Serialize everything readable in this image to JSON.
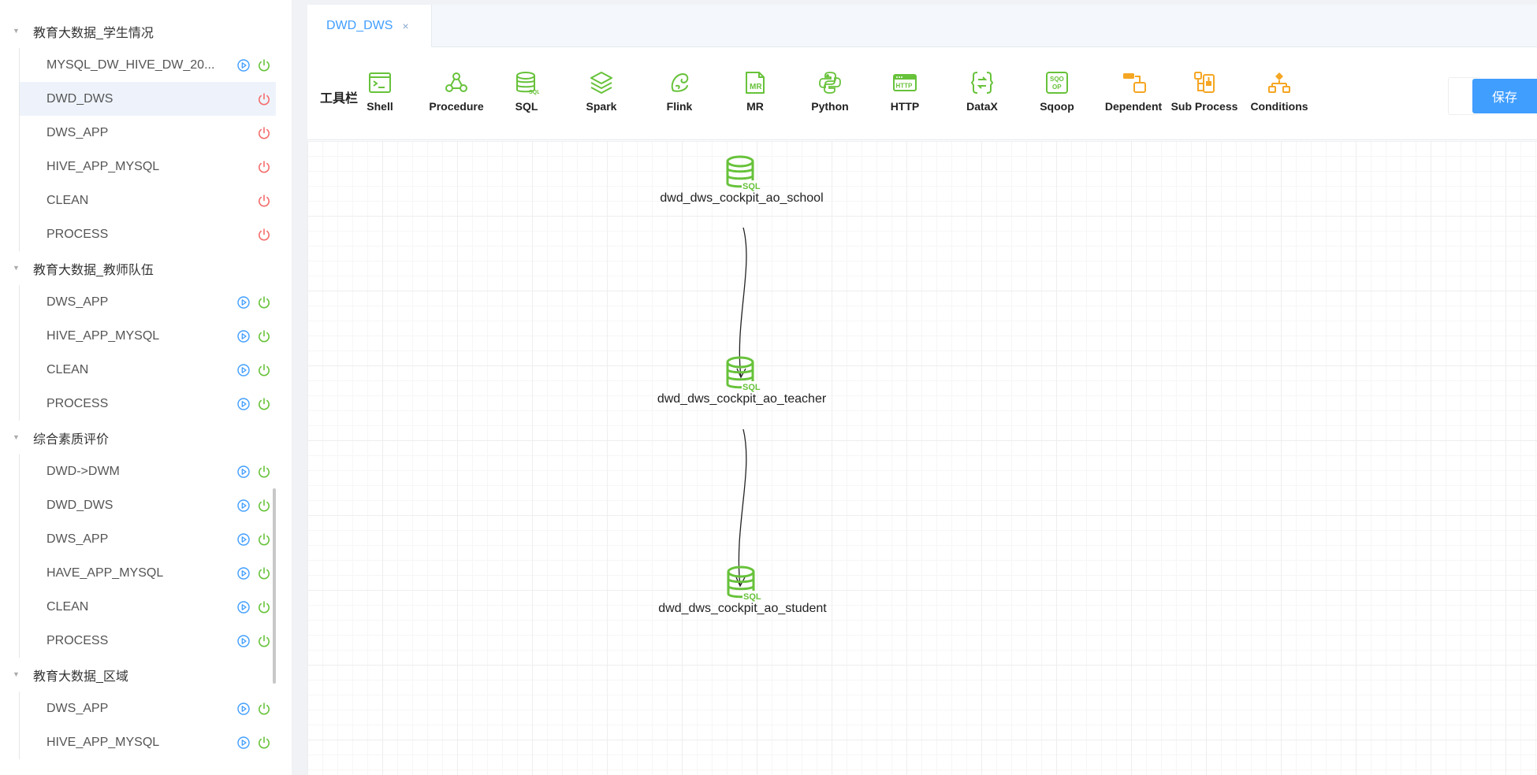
{
  "sidebar": {
    "groups": [
      {
        "label": "教育大数据_学生情况",
        "items": [
          {
            "label": "MYSQL_DW_HIVE_DW_20...",
            "run": true,
            "status": "green",
            "active": false
          },
          {
            "label": "DWD_DWS",
            "run": false,
            "status": "red",
            "active": true
          },
          {
            "label": "DWS_APP",
            "run": false,
            "status": "red",
            "active": false
          },
          {
            "label": "HIVE_APP_MYSQL",
            "run": false,
            "status": "red",
            "active": false
          },
          {
            "label": "CLEAN",
            "run": false,
            "status": "red",
            "active": false
          },
          {
            "label": "PROCESS",
            "run": false,
            "status": "red",
            "active": false
          }
        ]
      },
      {
        "label": "教育大数据_教师队伍",
        "items": [
          {
            "label": "DWS_APP",
            "run": true,
            "status": "green",
            "active": false
          },
          {
            "label": "HIVE_APP_MYSQL",
            "run": true,
            "status": "green",
            "active": false
          },
          {
            "label": "CLEAN",
            "run": true,
            "status": "green",
            "active": false
          },
          {
            "label": "PROCESS",
            "run": true,
            "status": "green",
            "active": false
          }
        ]
      },
      {
        "label": "综合素质评价",
        "items": [
          {
            "label": "DWD->DWM",
            "run": true,
            "status": "green",
            "active": false
          },
          {
            "label": "DWD_DWS",
            "run": true,
            "status": "green",
            "active": false
          },
          {
            "label": "DWS_APP",
            "run": true,
            "status": "green",
            "active": false
          },
          {
            "label": "HAVE_APP_MYSQL",
            "run": true,
            "status": "green",
            "active": false
          },
          {
            "label": "CLEAN",
            "run": true,
            "status": "green",
            "active": false
          },
          {
            "label": "PROCESS",
            "run": true,
            "status": "green",
            "active": false
          }
        ]
      },
      {
        "label": "教育大数据_区域",
        "items": [
          {
            "label": "DWS_APP",
            "run": true,
            "status": "green",
            "active": false
          },
          {
            "label": "HIVE_APP_MYSQL",
            "run": true,
            "status": "green",
            "active": false
          }
        ]
      }
    ]
  },
  "tabs": [
    {
      "label": "DWD_DWS",
      "close": "×"
    }
  ],
  "toolbar": {
    "title": "工具栏",
    "tools": [
      {
        "label": "Shell",
        "icon": "shell-icon"
      },
      {
        "label": "Procedure",
        "icon": "procedure-icon"
      },
      {
        "label": "SQL",
        "icon": "sql-icon"
      },
      {
        "label": "Spark",
        "icon": "spark-icon"
      },
      {
        "label": "Flink",
        "icon": "flink-icon"
      },
      {
        "label": "MR",
        "icon": "mr-icon"
      },
      {
        "label": "Python",
        "icon": "python-icon"
      },
      {
        "label": "HTTP",
        "icon": "http-icon"
      },
      {
        "label": "DataX",
        "icon": "datax-icon"
      },
      {
        "label": "Sqoop",
        "icon": "sqoop-icon"
      },
      {
        "label": "Dependent",
        "icon": "dependent-icon"
      },
      {
        "label": "Sub Process",
        "icon": "sub-process-icon"
      },
      {
        "label": "Conditions",
        "icon": "conditions-icon"
      }
    ],
    "save_label": "保存"
  },
  "colors": {
    "accent": "#409eff",
    "green": "#67c23a",
    "red": "#f56c6c",
    "orange": "#f5a623"
  },
  "dag": {
    "nodes": [
      {
        "label": "dwd_dws_cockpit_ao_school",
        "type": "SQL"
      },
      {
        "label": "dwd_dws_cockpit_ao_teacher",
        "type": "SQL"
      },
      {
        "label": "dwd_dws_cockpit_ao_student",
        "type": "SQL"
      }
    ]
  }
}
